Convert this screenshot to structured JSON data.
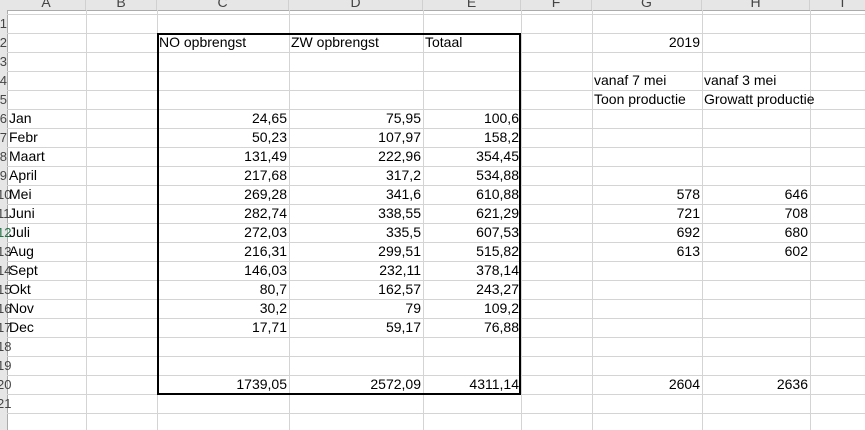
{
  "columns": [
    "A",
    "B",
    "C",
    "D",
    "E",
    "F",
    "G",
    "H",
    "I"
  ],
  "rows": [
    "1",
    "2",
    "3",
    "4",
    "5",
    "6",
    "7",
    "8",
    "9",
    "10",
    "11",
    "12",
    "13",
    "14",
    "15",
    "16",
    "17",
    "18",
    "19",
    "20",
    "21"
  ],
  "headers": {
    "c": "NO opbrengst",
    "d": "ZW opbrengst",
    "e": "Totaal",
    "g_year": "2019",
    "g_from": "vanaf  7 mei",
    "h_from": "vanaf 3 mei",
    "g_label": "Toon productie",
    "h_label": "Growatt productie"
  },
  "months": [
    {
      "name": "Jan",
      "c": "24,65",
      "d": "75,95",
      "e": "100,6",
      "g": "",
      "h": ""
    },
    {
      "name": "Febr",
      "c": "50,23",
      "d": "107,97",
      "e": "158,2",
      "g": "",
      "h": ""
    },
    {
      "name": "Maart",
      "c": "131,49",
      "d": "222,96",
      "e": "354,45",
      "g": "",
      "h": ""
    },
    {
      "name": "April",
      "c": "217,68",
      "d": "317,2",
      "e": "534,88",
      "g": "",
      "h": ""
    },
    {
      "name": "Mei",
      "c": "269,28",
      "d": "341,6",
      "e": "610,88",
      "g": "578",
      "h": "646"
    },
    {
      "name": "Juni",
      "c": "282,74",
      "d": "338,55",
      "e": "621,29",
      "g": "721",
      "h": "708"
    },
    {
      "name": "Juli",
      "c": "272,03",
      "d": "335,5",
      "e": "607,53",
      "g": "692",
      "h": "680"
    },
    {
      "name": "Aug",
      "c": "216,31",
      "d": "299,51",
      "e": "515,82",
      "g": "613",
      "h": "602"
    },
    {
      "name": "Sept",
      "c": "146,03",
      "d": "232,11",
      "e": "378,14",
      "g": "",
      "h": ""
    },
    {
      "name": "Okt",
      "c": "80,7",
      "d": "162,57",
      "e": "243,27",
      "g": "",
      "h": ""
    },
    {
      "name": "Nov",
      "c": "30,2",
      "d": "79",
      "e": "109,2",
      "g": "",
      "h": ""
    },
    {
      "name": "Dec",
      "c": "17,71",
      "d": "59,17",
      "e": "76,88",
      "g": "",
      "h": ""
    }
  ],
  "totals": {
    "c": "1739,05",
    "d": "2572,09",
    "e": "4311,14",
    "g": "2604",
    "h": "2636"
  },
  "selected_row": "12"
}
